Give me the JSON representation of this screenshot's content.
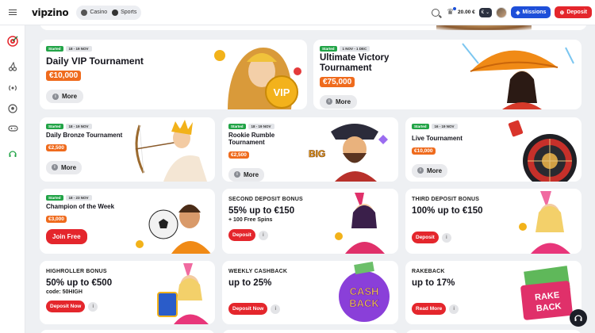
{
  "header": {
    "logo": "vipzino",
    "modes": [
      {
        "label": "Casino",
        "icon": "casino-chip-icon"
      },
      {
        "label": "Sports",
        "icon": "soccer-ball-icon"
      }
    ],
    "balance": "20.00 €",
    "wallet_label": "€",
    "missions_label": "Missions",
    "deposit_label": "Deposit"
  },
  "rail": {
    "items": [
      {
        "icon": "target-icon"
      },
      {
        "icon": "cherries-icon"
      },
      {
        "icon": "live-broadcast-icon"
      },
      {
        "icon": "soccer-ball-icon"
      },
      {
        "icon": "gamepad-icon"
      },
      {
        "icon": "headset-icon"
      }
    ]
  },
  "tournaments": [
    {
      "status": "Started",
      "dates": "18 - 19 NOV",
      "title": "Daily VIP Tournament",
      "prize": "€10,000",
      "button": "More"
    },
    {
      "status": "Started",
      "dates": "1 NOV - 1 DEC",
      "title": "Ultimate Victory Tournament",
      "prize": "€75,000",
      "button": "More"
    },
    {
      "status": "Started",
      "dates": "18 - 19 NOV",
      "title": "Daily Bronze Tournament",
      "prize": "€2,500",
      "button": "More"
    },
    {
      "status": "Started",
      "dates": "18 - 19 NOV",
      "title": "Rookie Rumble Tournament",
      "prize": "€2,500",
      "button": "More"
    },
    {
      "status": "Started",
      "dates": "16 - 19 NOV",
      "title": "Live Tournament",
      "prize": "€10,000",
      "button": "More"
    },
    {
      "status": "Started",
      "dates": "18 - 23 NOV",
      "title": "Champion of the Week",
      "prize": "€3,000",
      "button": "Join Free"
    }
  ],
  "bonuses": [
    {
      "kicker": "SECOND DEPOSIT BONUS",
      "main": "55% up to €150",
      "sub": "+ 100 Free Spins",
      "button": "Deposit"
    },
    {
      "kicker": "THIRD DEPOSIT BONUS",
      "main": "100% up to €150",
      "sub": "",
      "button": "Deposit"
    },
    {
      "kicker": "HIGHROLLER BONUS",
      "main": "50% up to €500",
      "sub": "code: 50HIGH",
      "button": "Deposit Now"
    },
    {
      "kicker": "WEEKLY CASHBACK",
      "main": "up to 25%",
      "sub": "",
      "button": "Deposit Now"
    },
    {
      "kicker": "RAKEBACK",
      "main": "up to 17%",
      "sub": "",
      "button": "Read More"
    }
  ],
  "art_text": {
    "vip": "VIP",
    "big_win": "BIG",
    "cashback_1": "CASH",
    "cashback_2": "BACK",
    "rakeback_1": "RAKE",
    "rakeback_2": "BACK"
  },
  "info_glyph": "i",
  "colors": {
    "accent_red": "#e4262c",
    "accent_blue": "#1e4fd9",
    "started_green": "#22a447",
    "prize_orange": "#ef6b1d"
  }
}
